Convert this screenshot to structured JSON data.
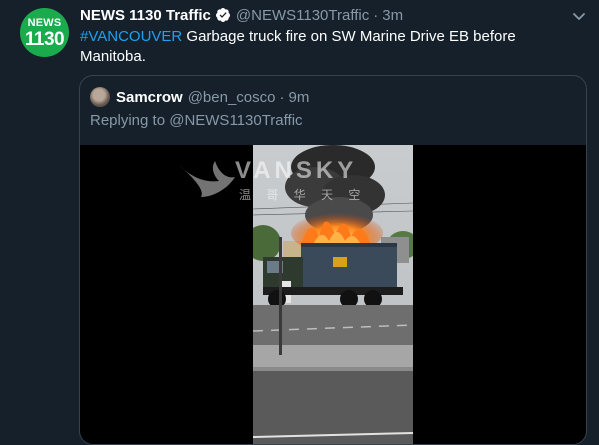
{
  "tweet": {
    "avatar": {
      "line1": "NEWS",
      "line2": "1130",
      "color": "#1aab4c"
    },
    "author_name": "NEWS 1130 Traffic",
    "verified_icon": "verified-badge-icon",
    "handle": "@NEWS1130Traffic",
    "separator": "·",
    "time": "3m",
    "menu_icon": "chevron-down-icon",
    "hashtag": "#VANCOUVER",
    "text": " Garbage truck fire on SW Marine Drive EB before Manitoba."
  },
  "quoted_tweet": {
    "author_name": "Samcrow",
    "handle": "@ben_cosco",
    "separator": "·",
    "time": "9m",
    "replying_to": "Replying to @NEWS1130Traffic",
    "media": {
      "type": "video",
      "subject": "garbage truck on fire",
      "watermark": {
        "title": "VANSKY",
        "subtitle": "温 哥 华 天 空"
      }
    }
  },
  "colors": {
    "background": "#15202b",
    "secondary_text": "#8899a6",
    "link": "#1da1f2",
    "border": "#38444d"
  }
}
